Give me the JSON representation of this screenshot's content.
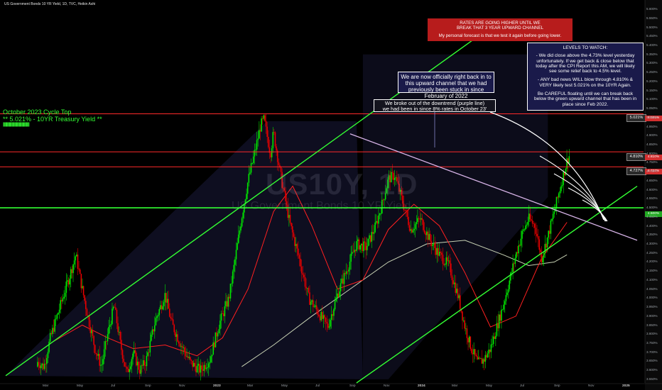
{
  "header": {
    "title": "US Government Bonds 10 YR Yield, 1D, TVC, Heikin Ashi"
  },
  "watermark": {
    "symbol": "US10Y, 1D",
    "description": "US Government Bonds 10 YR Yield"
  },
  "annotations": {
    "red_box": {
      "line1": "RATES ARE GOING HIGHER UNTIL WE",
      "line2": "BREAK THAT 3 YEAR UPWARD CHANNEL",
      "line3": "My personal forecast is that we test it again before going lower."
    },
    "levels_box": {
      "title": "LEVELS TO WATCH:",
      "p1": "- We did close above the 4.73% level yesterday unfortunately. If we get back & close below that today after the CPI Report this AM, we will likely see some relief back to 4.5% level.",
      "p2": "- ANY bad news WILL blow through 4.810% & VERY likely test 5.021% on the 10YR Again.",
      "p3": "Be CAREFUL floating until we can break back below the green upward channel that has been in place since Feb 2022."
    },
    "channel_box": {
      "text": "We are now officially right back in to this upward channel that we had previously been stuck in since February of 2022"
    },
    "downtrend_box": {
      "line1": "We broke out of the downtrend (purple line)",
      "line2": "we had been in since 8% rates in October 23'"
    },
    "cycle_top": {
      "line1": "October 2023 Cycle Top",
      "line2": "** 5.021% - 10YR Treasury Yield **",
      "bars": "||||||||||||||||||||||||||||||||||||||||||||||||||||||||||||||||||"
    }
  },
  "price_tags": {
    "level_5021": "5.021%",
    "level_4810": "4.810%",
    "level_4727": "4.727%",
    "axis_5021": "5.021%",
    "axis_4810": "4.810%",
    "axis_4727": "4.727%",
    "axis_4500": "4.500%"
  },
  "colors": {
    "background": "#000000",
    "candle_up": "#00e600",
    "candle_down": "#e60000",
    "channel": "#33ff33",
    "resistance": "#ff2a2a",
    "downtrend": "#d8b4e8",
    "ma_fast": "#ff2020",
    "ma_slow": "#c8d2b4",
    "shade": "#1a1a3a",
    "arrow": "#ffffff"
  },
  "chart_data": {
    "type": "candlestick",
    "title": "US Government Bonds 10 YR Yield, 1D, TVC, Heikin Ashi",
    "xlabel": "",
    "ylabel": "",
    "ylim": [
      3.53,
      5.62
    ],
    "grid": false,
    "legend": "none",
    "y_ticks": [
      "5.600%",
      "5.550%",
      "5.500%",
      "5.450%",
      "5.400%",
      "5.350%",
      "5.300%",
      "5.250%",
      "5.200%",
      "5.150%",
      "5.100%",
      "5.050%",
      "5.000%",
      "4.950%",
      "4.900%",
      "4.850%",
      "4.800%",
      "4.750%",
      "4.700%",
      "4.650%",
      "4.600%",
      "4.550%",
      "4.500%",
      "4.450%",
      "4.400%",
      "4.350%",
      "4.300%",
      "4.250%",
      "4.200%",
      "4.150%",
      "4.100%",
      "4.050%",
      "4.000%",
      "3.950%",
      "3.900%",
      "3.850%",
      "3.800%",
      "3.750%",
      "3.700%",
      "3.650%",
      "3.600%",
      "3.550%"
    ],
    "x_ticks": [
      {
        "label": "Mar",
        "bold": false
      },
      {
        "label": "May",
        "bold": false
      },
      {
        "label": "Jul",
        "bold": false
      },
      {
        "label": "Sep",
        "bold": false
      },
      {
        "label": "Nov",
        "bold": false
      },
      {
        "label": "2023",
        "bold": true
      },
      {
        "label": "Mar",
        "bold": false
      },
      {
        "label": "May",
        "bold": false
      },
      {
        "label": "Jul",
        "bold": false
      },
      {
        "label": "Sep",
        "bold": false
      },
      {
        "label": "Nov",
        "bold": false
      },
      {
        "label": "2024",
        "bold": true
      },
      {
        "label": "Mar",
        "bold": false
      },
      {
        "label": "May",
        "bold": false
      },
      {
        "label": "Jul",
        "bold": false
      },
      {
        "label": "Sep",
        "bold": false
      },
      {
        "label": "Nov",
        "bold": false
      },
      {
        "label": "2025",
        "bold": true
      }
    ],
    "horizontal_levels": [
      {
        "name": "5.021%",
        "value": 5.021,
        "color": "#ff2a2a"
      },
      {
        "name": "4.810%",
        "value": 4.81,
        "color": "#ff2a2a"
      },
      {
        "name": "4.727%",
        "value": 4.727,
        "color": "#ff2a2a"
      },
      {
        "name": "4.500%",
        "value": 4.5,
        "color": "#33ff33"
      }
    ],
    "price_path": [
      [
        0.0,
        3.62
      ],
      [
        0.015,
        3.64
      ],
      [
        0.03,
        3.6
      ],
      [
        0.045,
        3.66
      ],
      [
        0.06,
        3.62
      ],
      [
        0.07,
        3.78
      ],
      [
        0.085,
        3.95
      ],
      [
        0.1,
        4.12
      ],
      [
        0.11,
        4.24
      ],
      [
        0.12,
        4.05
      ],
      [
        0.13,
        3.88
      ],
      [
        0.14,
        3.72
      ],
      [
        0.15,
        3.62
      ],
      [
        0.16,
        3.8
      ],
      [
        0.17,
        3.96
      ],
      [
        0.18,
        3.74
      ],
      [
        0.19,
        3.58
      ],
      [
        0.2,
        3.7
      ],
      [
        0.21,
        3.6
      ],
      [
        0.22,
        3.65
      ],
      [
        0.235,
        3.88
      ],
      [
        0.25,
        4.02
      ],
      [
        0.26,
        3.86
      ],
      [
        0.275,
        3.74
      ],
      [
        0.29,
        3.64
      ],
      [
        0.305,
        3.6
      ],
      [
        0.32,
        3.66
      ],
      [
        0.335,
        3.86
      ],
      [
        0.35,
        4.0
      ],
      [
        0.36,
        4.22
      ],
      [
        0.37,
        4.45
      ],
      [
        0.38,
        4.65
      ],
      [
        0.39,
        4.8
      ],
      [
        0.4,
        4.96
      ],
      [
        0.405,
        4.99
      ],
      [
        0.415,
        4.8
      ],
      [
        0.42,
        4.92
      ],
      [
        0.43,
        4.7
      ],
      [
        0.445,
        4.42
      ],
      [
        0.46,
        4.22
      ],
      [
        0.475,
        4.0
      ],
      [
        0.49,
        3.92
      ],
      [
        0.505,
        3.84
      ],
      [
        0.52,
        4.02
      ],
      [
        0.535,
        4.16
      ],
      [
        0.55,
        4.3
      ],
      [
        0.565,
        4.28
      ],
      [
        0.58,
        4.4
      ],
      [
        0.59,
        4.52
      ],
      [
        0.6,
        4.66
      ],
      [
        0.61,
        4.68
      ],
      [
        0.62,
        4.56
      ],
      [
        0.635,
        4.38
      ],
      [
        0.65,
        4.44
      ],
      [
        0.665,
        4.32
      ],
      [
        0.68,
        4.24
      ],
      [
        0.695,
        4.18
      ],
      [
        0.71,
        4.0
      ],
      [
        0.72,
        3.84
      ],
      [
        0.73,
        3.72
      ],
      [
        0.74,
        3.64
      ],
      [
        0.75,
        3.66
      ],
      [
        0.76,
        3.72
      ],
      [
        0.77,
        3.84
      ],
      [
        0.78,
        3.96
      ],
      [
        0.79,
        4.1
      ],
      [
        0.8,
        4.24
      ],
      [
        0.81,
        4.36
      ],
      [
        0.82,
        4.44
      ],
      [
        0.83,
        4.4
      ],
      [
        0.84,
        4.22
      ],
      [
        0.85,
        4.34
      ],
      [
        0.86,
        4.48
      ],
      [
        0.87,
        4.62
      ],
      [
        0.88,
        4.76
      ],
      [
        0.885,
        4.8
      ]
    ],
    "ma_fast": [
      [
        0.07,
        3.75
      ],
      [
        0.12,
        3.85
      ],
      [
        0.16,
        3.78
      ],
      [
        0.2,
        3.72
      ],
      [
        0.25,
        3.74
      ],
      [
        0.3,
        3.68
      ],
      [
        0.34,
        3.78
      ],
      [
        0.38,
        4.05
      ],
      [
        0.42,
        4.48
      ],
      [
        0.45,
        4.62
      ],
      [
        0.48,
        4.4
      ],
      [
        0.52,
        4.05
      ],
      [
        0.56,
        4.1
      ],
      [
        0.6,
        4.38
      ],
      [
        0.64,
        4.52
      ],
      [
        0.68,
        4.4
      ],
      [
        0.72,
        4.14
      ],
      [
        0.76,
        3.84
      ],
      [
        0.8,
        3.9
      ],
      [
        0.84,
        4.22
      ],
      [
        0.88,
        4.42
      ]
    ],
    "ma_slow": [
      [
        0.37,
        3.62
      ],
      [
        0.42,
        3.74
      ],
      [
        0.48,
        3.9
      ],
      [
        0.54,
        4.05
      ],
      [
        0.6,
        4.2
      ],
      [
        0.66,
        4.3
      ],
      [
        0.72,
        4.32
      ],
      [
        0.78,
        4.24
      ],
      [
        0.82,
        4.18
      ],
      [
        0.86,
        4.2
      ],
      [
        0.88,
        4.24
      ]
    ]
  }
}
